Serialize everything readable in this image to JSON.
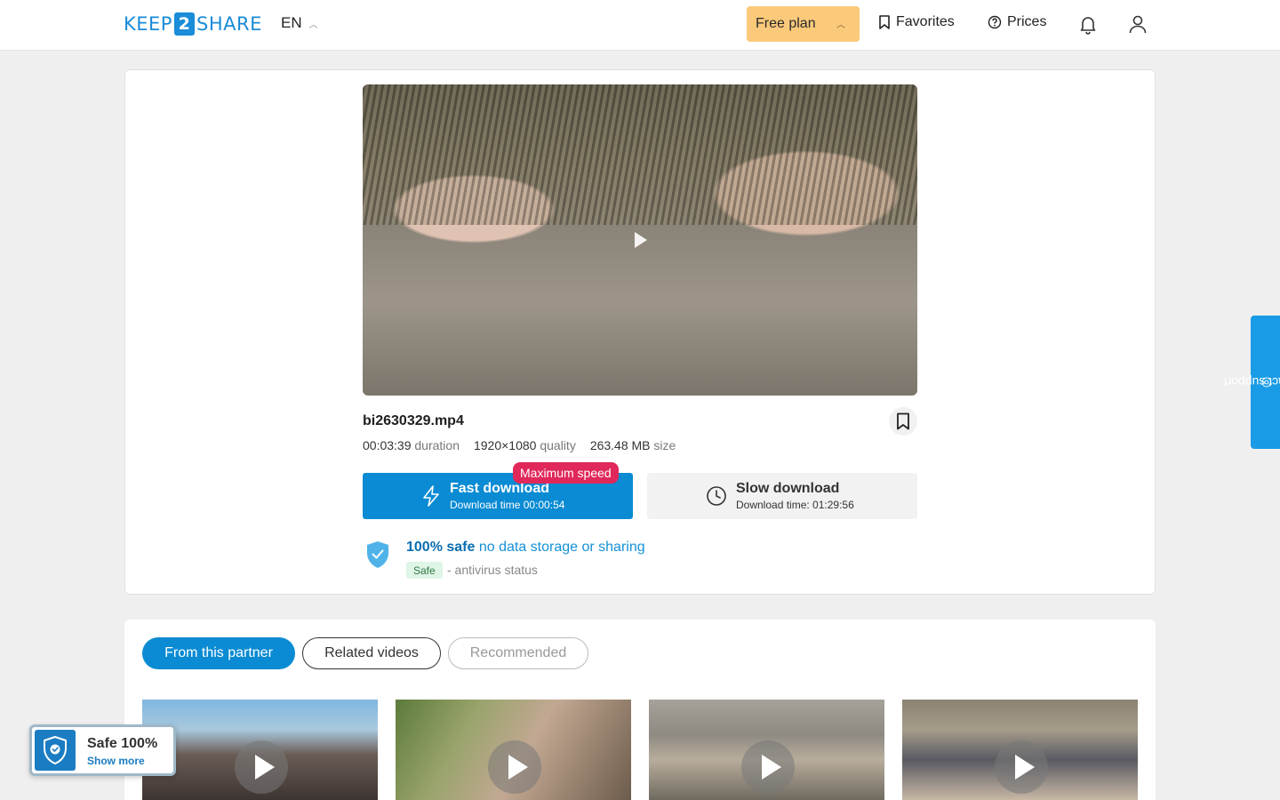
{
  "header": {
    "logo_left": "KEEP",
    "logo_mid": "2",
    "logo_right": "SHARE",
    "lang": "EN",
    "free_plan": "Free plan",
    "favorites": "Favorites",
    "prices": "Prices"
  },
  "file": {
    "name": "bi2630329.mp4",
    "duration_value": "00:03:39",
    "duration_label": "duration",
    "quality_value": "1920×1080",
    "quality_label": "quality",
    "size_value": "263.48 MB",
    "size_label": "size"
  },
  "download": {
    "badge": "Maximum speed",
    "fast_title": "Fast download",
    "fast_sub": "Download time 00:00:54",
    "slow_title": "Slow download",
    "slow_sub": "Download time: 01:29:56"
  },
  "safety": {
    "title_bold": "100% safe",
    "title_rest": "no data storage or sharing",
    "badge": "Safe",
    "status": "- antivirus status"
  },
  "contact_support": "contact support",
  "tabs": [
    "From this partner",
    "Related videos",
    "Recommended"
  ],
  "safe_widget": {
    "title": "Safe 100%",
    "more": "Show more"
  },
  "colors": {
    "accent": "#0a8bd3",
    "plan": "#fbc97a",
    "badge": "#e0285a"
  }
}
